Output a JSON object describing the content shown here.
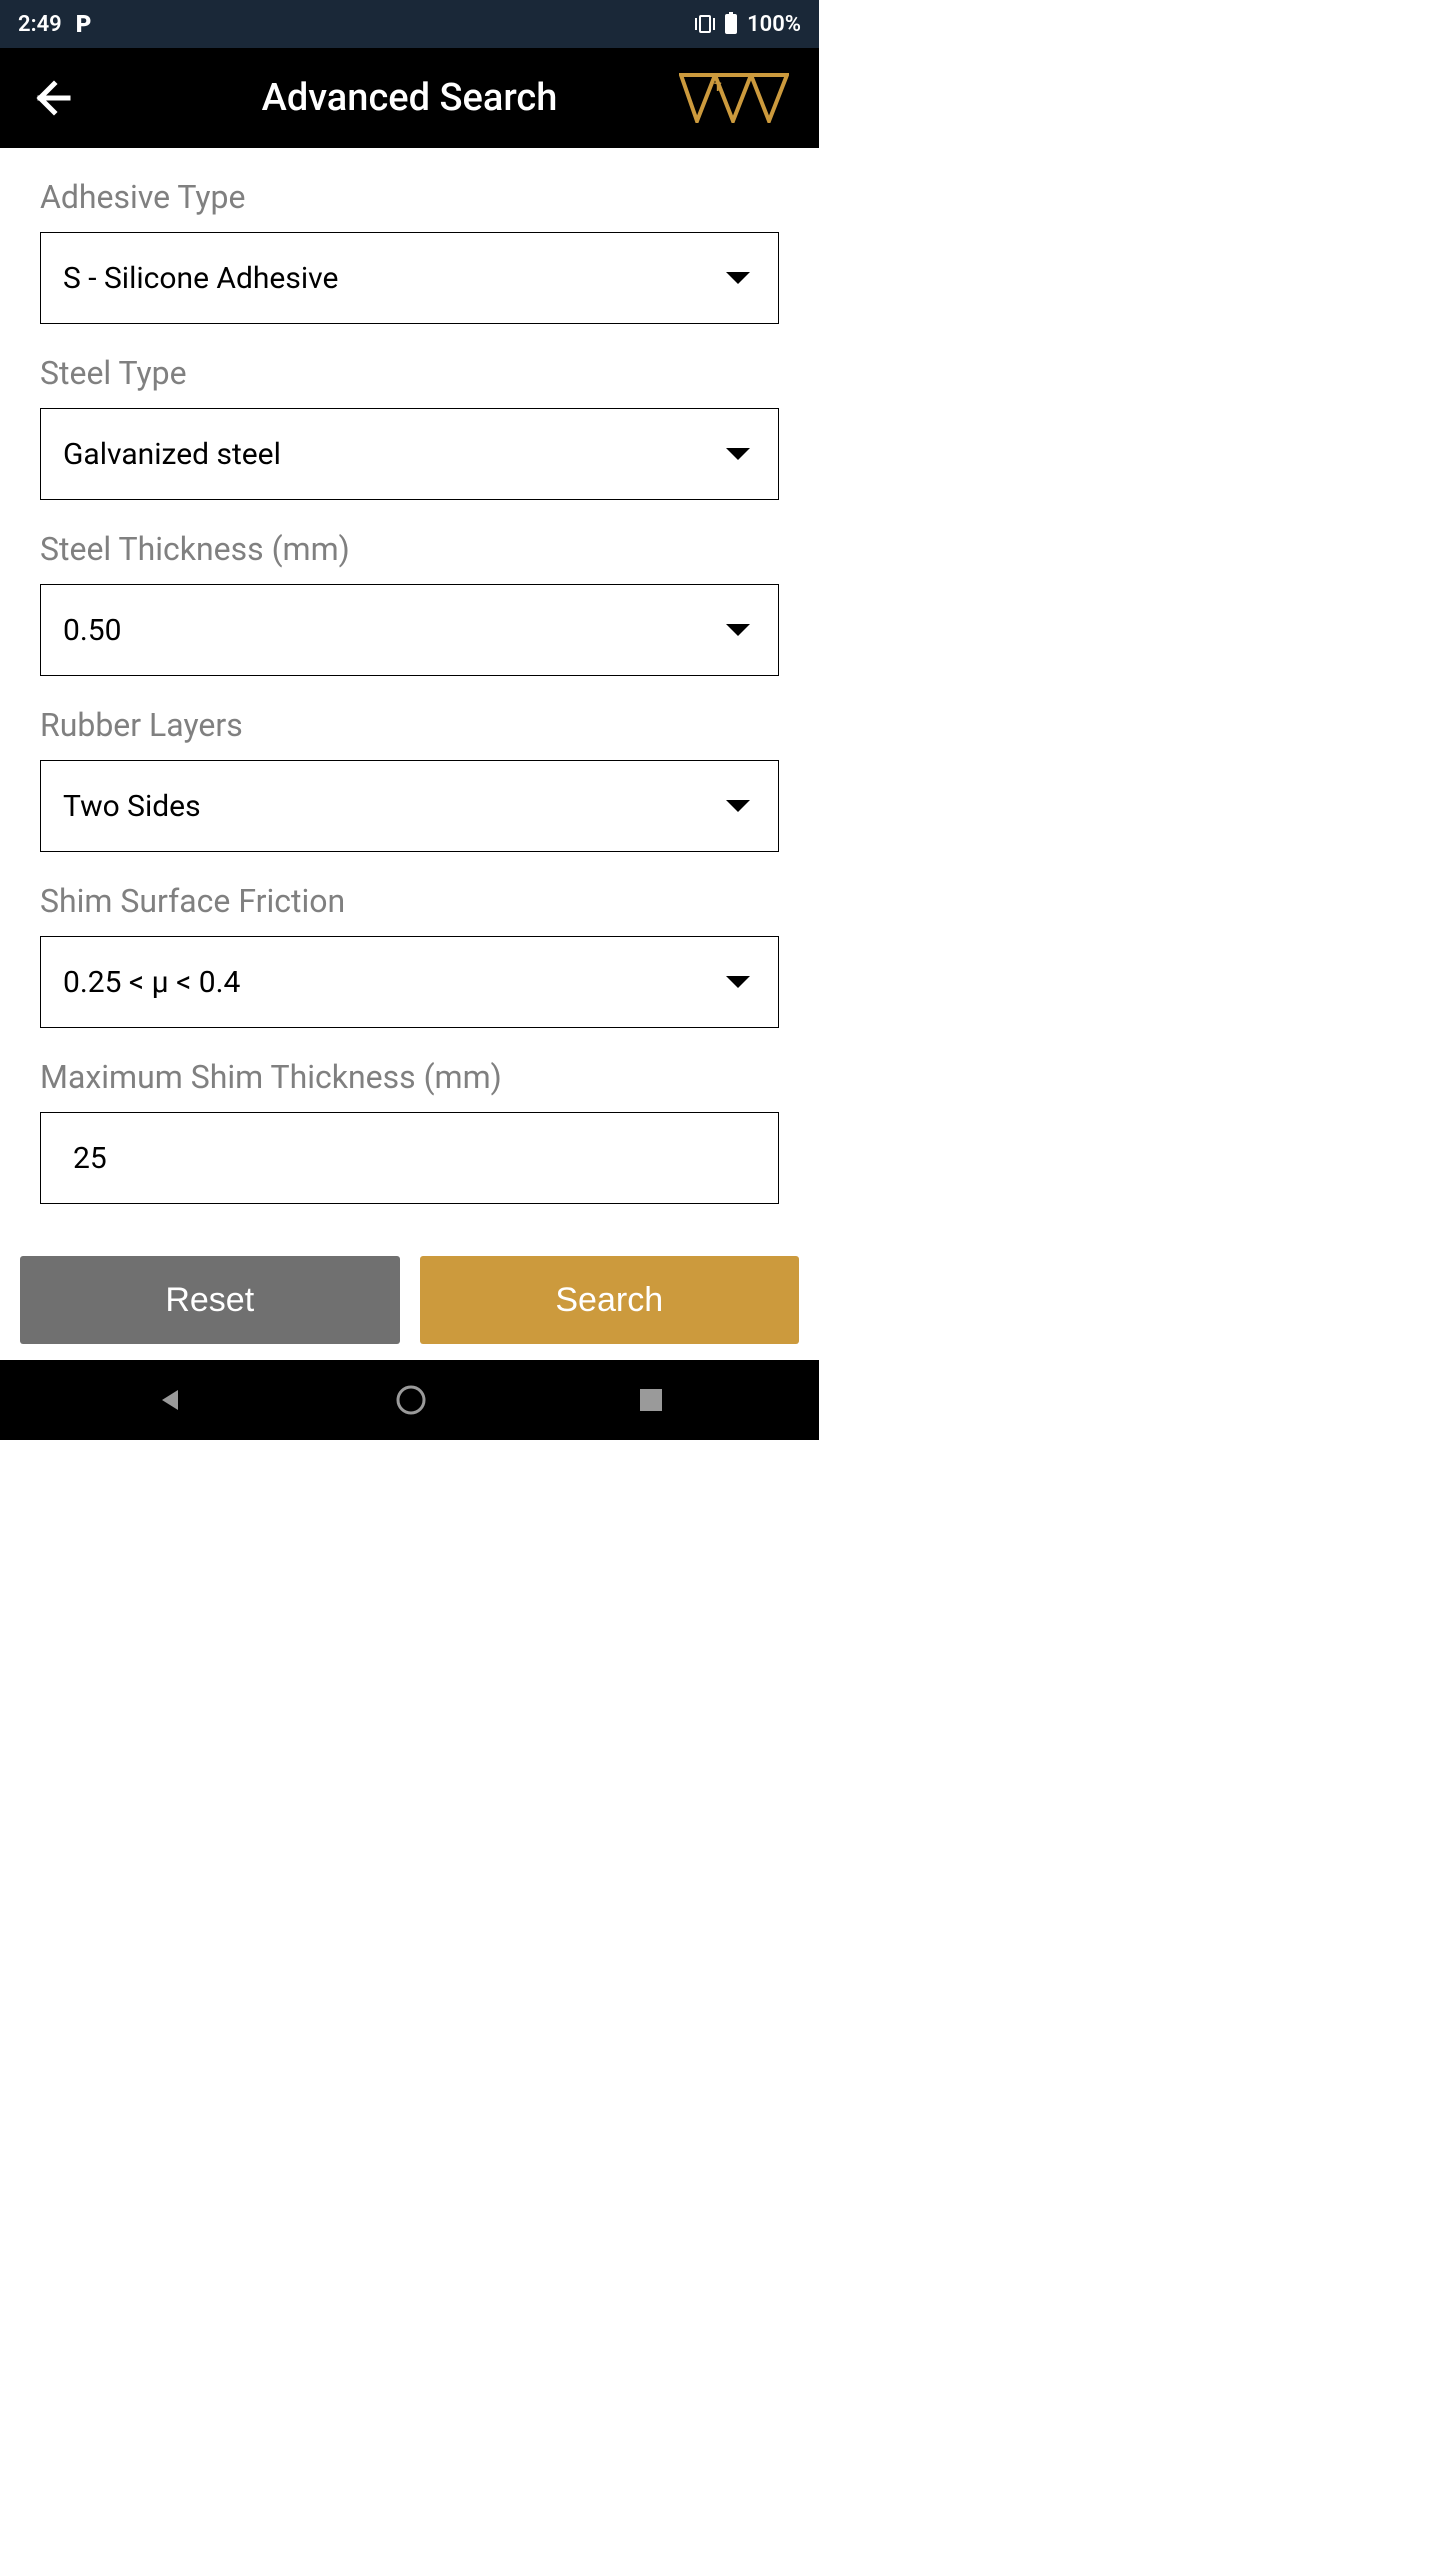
{
  "status_bar": {
    "time": "2:49",
    "battery": "100%"
  },
  "header": {
    "title": "Advanced Search"
  },
  "form": {
    "adhesive_type": {
      "label": "Adhesive Type",
      "value": "S - Silicone Adhesive"
    },
    "steel_type": {
      "label": "Steel Type",
      "value": "Galvanized steel"
    },
    "steel_thickness": {
      "label": "Steel Thickness (mm)",
      "value": "0.50"
    },
    "rubber_layers": {
      "label": "Rubber Layers",
      "value": "Two Sides"
    },
    "shim_surface_friction": {
      "label": "Shim Surface Friction",
      "value": "0.25 < μ < 0.4"
    },
    "max_shim_thickness": {
      "label": "Maximum Shim Thickness (mm)",
      "value": "25"
    }
  },
  "buttons": {
    "reset": "Reset",
    "search": "Search"
  }
}
